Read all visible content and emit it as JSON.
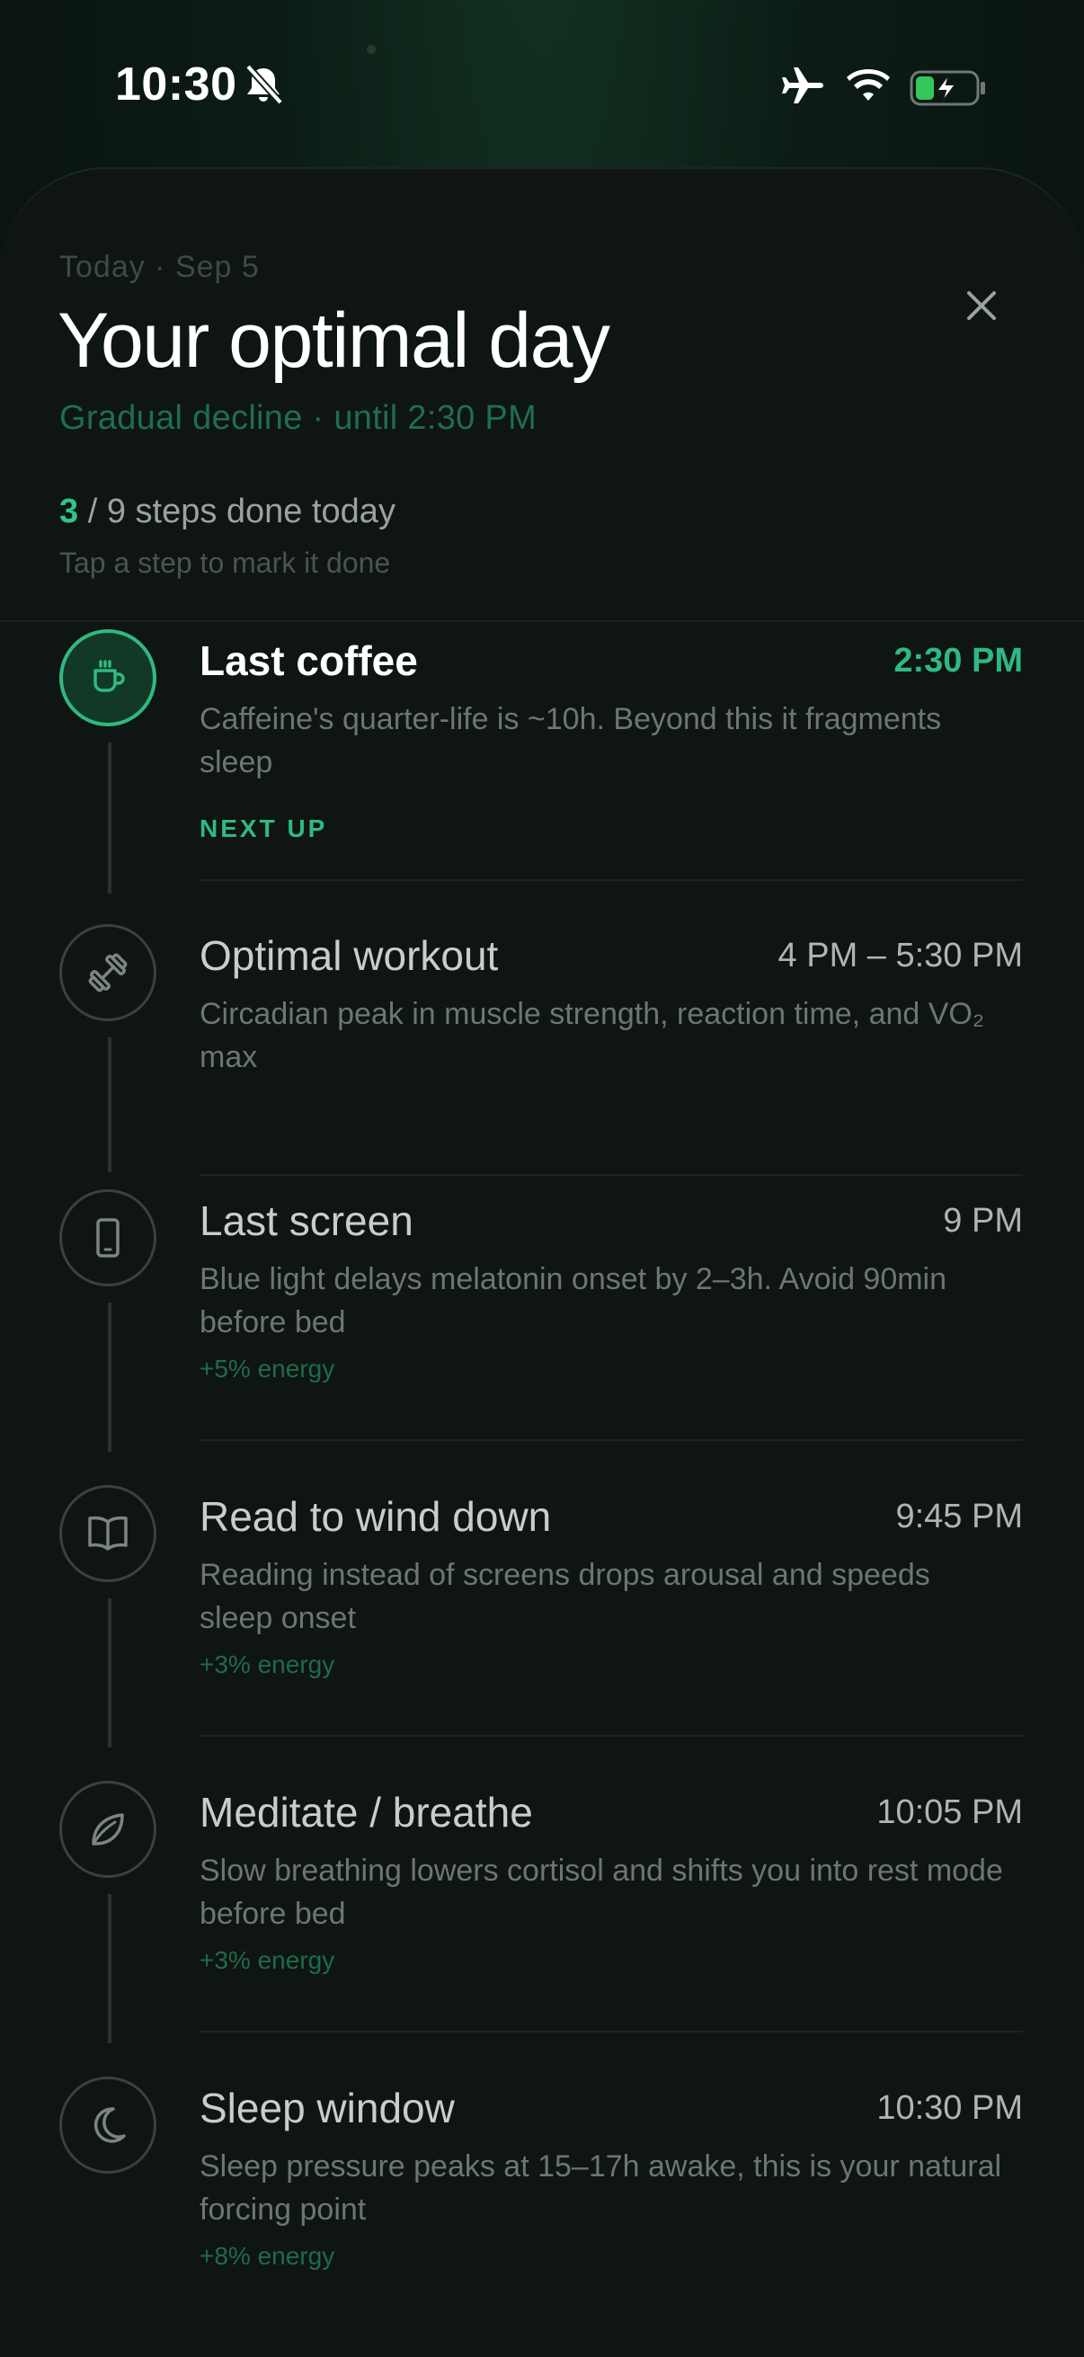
{
  "status_bar": {
    "time": "10:30",
    "icons": [
      "bell-muted-icon",
      "airplane-icon",
      "wifi-icon",
      "battery-charging-icon"
    ]
  },
  "header": {
    "date": "Today · Sep 5",
    "title": "Your optimal day",
    "subtitle": "Gradual decline · until 2:30 PM",
    "progress_done": "3",
    "progress_rest": "/ 9 steps done today",
    "hint": "Tap a step to mark it done",
    "close_icon": "close-icon"
  },
  "colors": {
    "accent": "#2fb982",
    "background": "#0e1513"
  },
  "steps": [
    {
      "title": "Last coffee",
      "time": "2:30 PM",
      "description": "Caffeine's quarter-life is ~10h. Beyond this it fragments sleep",
      "tag": "NEXT UP",
      "icon": "coffee-cup-icon",
      "active": true
    },
    {
      "title": "Optimal workout",
      "time": "4 PM – 5:30 PM",
      "description": "Circadian peak in muscle strength, reaction time, and VO₂ max",
      "tag": "",
      "icon": "dumbbell-icon",
      "active": false
    },
    {
      "title": "Last screen",
      "time": "9 PM",
      "description": "Blue light delays melatonin onset by 2–3h. Avoid 90min before bed",
      "tag": "+5% energy",
      "icon": "phone-icon",
      "active": false
    },
    {
      "title": "Read to wind down",
      "time": "9:45 PM",
      "description": "Reading instead of screens drops arousal and speeds sleep onset",
      "tag": "+3% energy",
      "icon": "book-icon",
      "active": false
    },
    {
      "title": "Meditate / breathe",
      "time": "10:05 PM",
      "description": "Slow breathing lowers cortisol and shifts you into rest mode before bed",
      "tag": "+3% energy",
      "icon": "leaf-icon",
      "active": false
    },
    {
      "title": "Sleep window",
      "time": "10:30 PM",
      "description": "Sleep pressure peaks at 15–17h awake, this is your natural forcing point",
      "tag": "+8% energy",
      "icon": "moon-icon",
      "active": false
    }
  ]
}
